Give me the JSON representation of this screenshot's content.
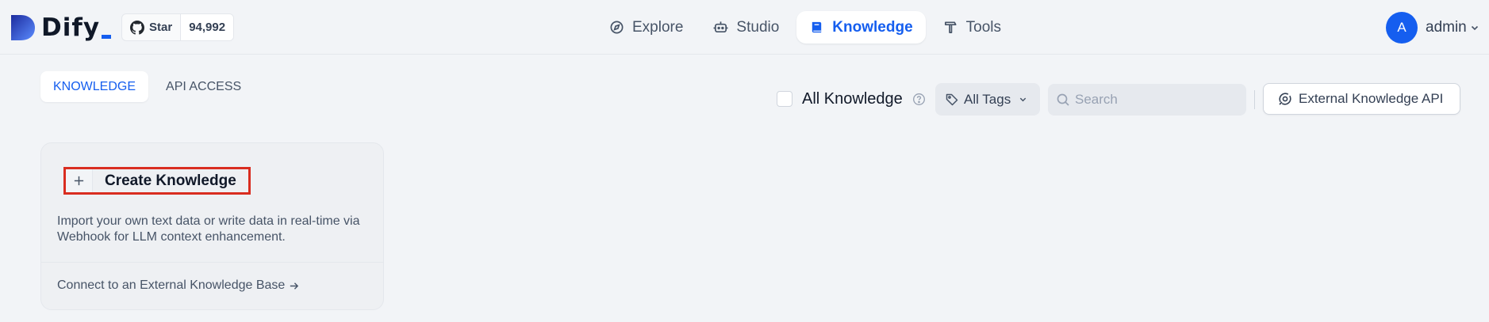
{
  "brand": {
    "name": "Dify",
    "accent": "#155eef"
  },
  "github": {
    "star_label": "Star",
    "star_count": "94,992",
    "icon": "github-icon"
  },
  "nav": {
    "items": [
      {
        "label": "Explore",
        "icon": "compass-icon",
        "active": false
      },
      {
        "label": "Studio",
        "icon": "robot-icon",
        "active": false
      },
      {
        "label": "Knowledge",
        "icon": "book-icon",
        "active": true
      },
      {
        "label": "Tools",
        "icon": "hammer-icon",
        "active": false
      }
    ]
  },
  "user": {
    "initial": "A",
    "name": "admin"
  },
  "tabs": [
    {
      "label": "KNOWLEDGE",
      "active": true
    },
    {
      "label": "API ACCESS",
      "active": false
    }
  ],
  "filters": {
    "all_knowledge_label": "All Knowledge",
    "tags_label": "All Tags",
    "search_placeholder": "Search",
    "external_api_label": "External Knowledge API"
  },
  "create_card": {
    "title": "Create Knowledge",
    "description": "Import your own text data or write data in real-time via Webhook for LLM context enhancement.",
    "connect_label": "Connect to an External Knowledge Base"
  }
}
